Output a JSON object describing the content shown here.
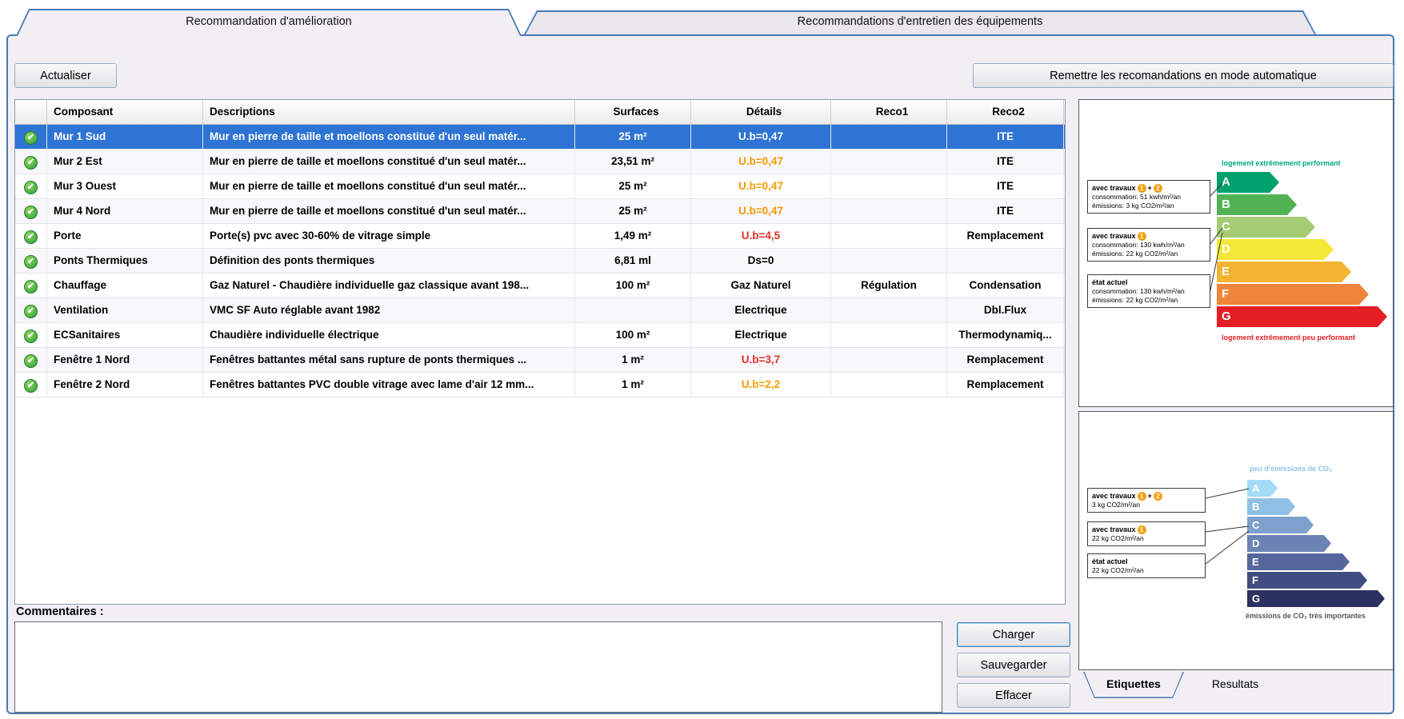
{
  "colors": {
    "accent_border": "#4a79b2",
    "selected_row": "#2e74d4",
    "warning_orange": "#f59b00",
    "alert_red": "#e0312b",
    "ok_green": "#3fae49"
  },
  "top_tabs": [
    {
      "label": "Recommandation d'amélioration",
      "active": true
    },
    {
      "label": "Recommandations d'entretien des équipements",
      "active": false
    }
  ],
  "toolbar": {
    "actualiser_label": "Actualiser",
    "remettre_label": "Remettre les recomandations en mode automatique"
  },
  "table": {
    "headers": {
      "composant": "Composant",
      "descriptions": "Descriptions",
      "surfaces": "Surfaces",
      "details": "Détails",
      "reco1": "Reco1",
      "reco2": "Reco2"
    },
    "rows": [
      {
        "composant": "Mur 1 Sud",
        "description": "Mur en pierre de taille et moellons constitué d'un seul matér...",
        "surface": "25 m²",
        "details": "U.b=0,47",
        "details_color": "#ffffff",
        "reco1": "",
        "reco2": "ITE",
        "selected": true
      },
      {
        "composant": "Mur 2 Est",
        "description": "Mur en pierre de taille et moellons constitué d'un seul matér...",
        "surface": "23,51 m²",
        "details": "U.b=0,47",
        "details_color": "#f59b00",
        "reco1": "",
        "reco2": "ITE",
        "selected": false
      },
      {
        "composant": "Mur 3 Ouest",
        "description": "Mur en pierre de taille et moellons constitué d'un seul matér...",
        "surface": "25 m²",
        "details": "U.b=0,47",
        "details_color": "#f59b00",
        "reco1": "",
        "reco2": "ITE",
        "selected": false
      },
      {
        "composant": "Mur 4 Nord",
        "description": "Mur en pierre de taille et moellons constitué d'un seul matér...",
        "surface": "25 m²",
        "details": "U.b=0,47",
        "details_color": "#f59b00",
        "reco1": "",
        "reco2": "ITE",
        "selected": false
      },
      {
        "composant": "Porte",
        "description": "Porte(s) pvc avec 30-60% de vitrage simple",
        "surface": "1,49 m²",
        "details": "U.b=4,5",
        "details_color": "#e0312b",
        "reco1": "",
        "reco2": "Remplacement",
        "selected": false
      },
      {
        "composant": "Ponts Thermiques",
        "description": "Définition des ponts thermiques",
        "surface": "6,81 ml",
        "details": "Ds=0",
        "details_color": "#000000",
        "reco1": "",
        "reco2": "",
        "selected": false
      },
      {
        "composant": "Chauffage",
        "description": "Gaz Naturel - Chaudière individuelle gaz classique avant 198...",
        "surface": "100 m²",
        "details": "Gaz Naturel",
        "details_color": "#000000",
        "reco1": "Régulation",
        "reco2": "Condensation",
        "selected": false
      },
      {
        "composant": "Ventilation",
        "description": "VMC SF Auto réglable avant 1982",
        "surface": "",
        "details": "Electrique",
        "details_color": "#000000",
        "reco1": "",
        "reco2": "Dbl.Flux",
        "selected": false
      },
      {
        "composant": "ECSanitaires",
        "description": "Chaudière individuelle électrique",
        "surface": "100 m²",
        "details": "Electrique",
        "details_color": "#000000",
        "reco1": "",
        "reco2": "Thermodynamiq...",
        "selected": false
      },
      {
        "composant": "Fenêtre 1 Nord",
        "description": "Fenêtres battantes métal sans rupture de ponts thermiques ...",
        "surface": "1 m²",
        "details": "U.b=3,7",
        "details_color": "#e0312b",
        "reco1": "",
        "reco2": "Remplacement",
        "selected": false
      },
      {
        "composant": "Fenêtre 2 Nord",
        "description": "Fenêtres battantes PVC double vitrage avec lame d'air 12 mm...",
        "surface": "1 m²",
        "details": "U.b=2,2",
        "details_color": "#f59b00",
        "reco1": "",
        "reco2": "Remplacement",
        "selected": false
      }
    ]
  },
  "comments": {
    "label": "Commentaires :",
    "value": ""
  },
  "side_buttons": {
    "charger": "Charger",
    "sauvegarder": "Sauvegarder",
    "effacer": "Effacer"
  },
  "energy_chart": {
    "type": "dpe-energy-label",
    "top_label": "logement extrêmement performant",
    "bottom_label": "logement extrêmement peu performant",
    "classes": [
      {
        "letter": "A",
        "color": "#00a06d"
      },
      {
        "letter": "B",
        "color": "#52b153"
      },
      {
        "letter": "C",
        "color": "#a5cc74"
      },
      {
        "letter": "D",
        "color": "#f4e737"
      },
      {
        "letter": "E",
        "color": "#f3b432"
      },
      {
        "letter": "F",
        "color": "#ec8439"
      },
      {
        "letter": "G",
        "color": "#e31e24"
      }
    ],
    "annotations": [
      {
        "title": "avec travaux",
        "badges": [
          "1",
          "2"
        ],
        "lines": [
          "consommation: 51 kwh/m²/an",
          "émissions: 3 kg CO2/m²/an"
        ],
        "target_class": "A"
      },
      {
        "title": "avec travaux",
        "badges": [
          "1"
        ],
        "lines": [
          "consommation: 130 kwh/m²/an",
          "émissions: 22 kg CO2/m²/an"
        ],
        "target_class": "C"
      },
      {
        "title": "état actuel",
        "badges": [],
        "lines": [
          "consommation: 130 kwh/m²/an",
          "émissions: 22 kg CO2/m²/an"
        ],
        "target_class": "C"
      }
    ]
  },
  "co2_chart": {
    "type": "dpe-co2-label",
    "top_label": "peu d'émissions de CO₂",
    "bottom_label": "émissions de CO₂ très importantes",
    "classes": [
      {
        "letter": "A",
        "color": "#a3dcf7"
      },
      {
        "letter": "B",
        "color": "#8fbfe4"
      },
      {
        "letter": "C",
        "color": "#7da0cc"
      },
      {
        "letter": "D",
        "color": "#6b84b4"
      },
      {
        "letter": "E",
        "color": "#56679b"
      },
      {
        "letter": "F",
        "color": "#414d80"
      },
      {
        "letter": "G",
        "color": "#2b3160"
      }
    ],
    "annotations": [
      {
        "title": "avec travaux",
        "badges": [
          "1",
          "2"
        ],
        "lines": [
          "3 kg CO2/m²/an"
        ],
        "target_class": "A"
      },
      {
        "title": "avec travaux",
        "badges": [
          "1"
        ],
        "lines": [
          "22 kg CO2/m²/an"
        ],
        "target_class": "C"
      },
      {
        "title": "état actuel",
        "badges": [],
        "lines": [
          "22 kg CO2/m²/an"
        ],
        "target_class": "C"
      }
    ]
  },
  "bottom_tabs": [
    {
      "label": "Etiquettes",
      "active": true
    },
    {
      "label": "Resultats",
      "active": false
    }
  ]
}
